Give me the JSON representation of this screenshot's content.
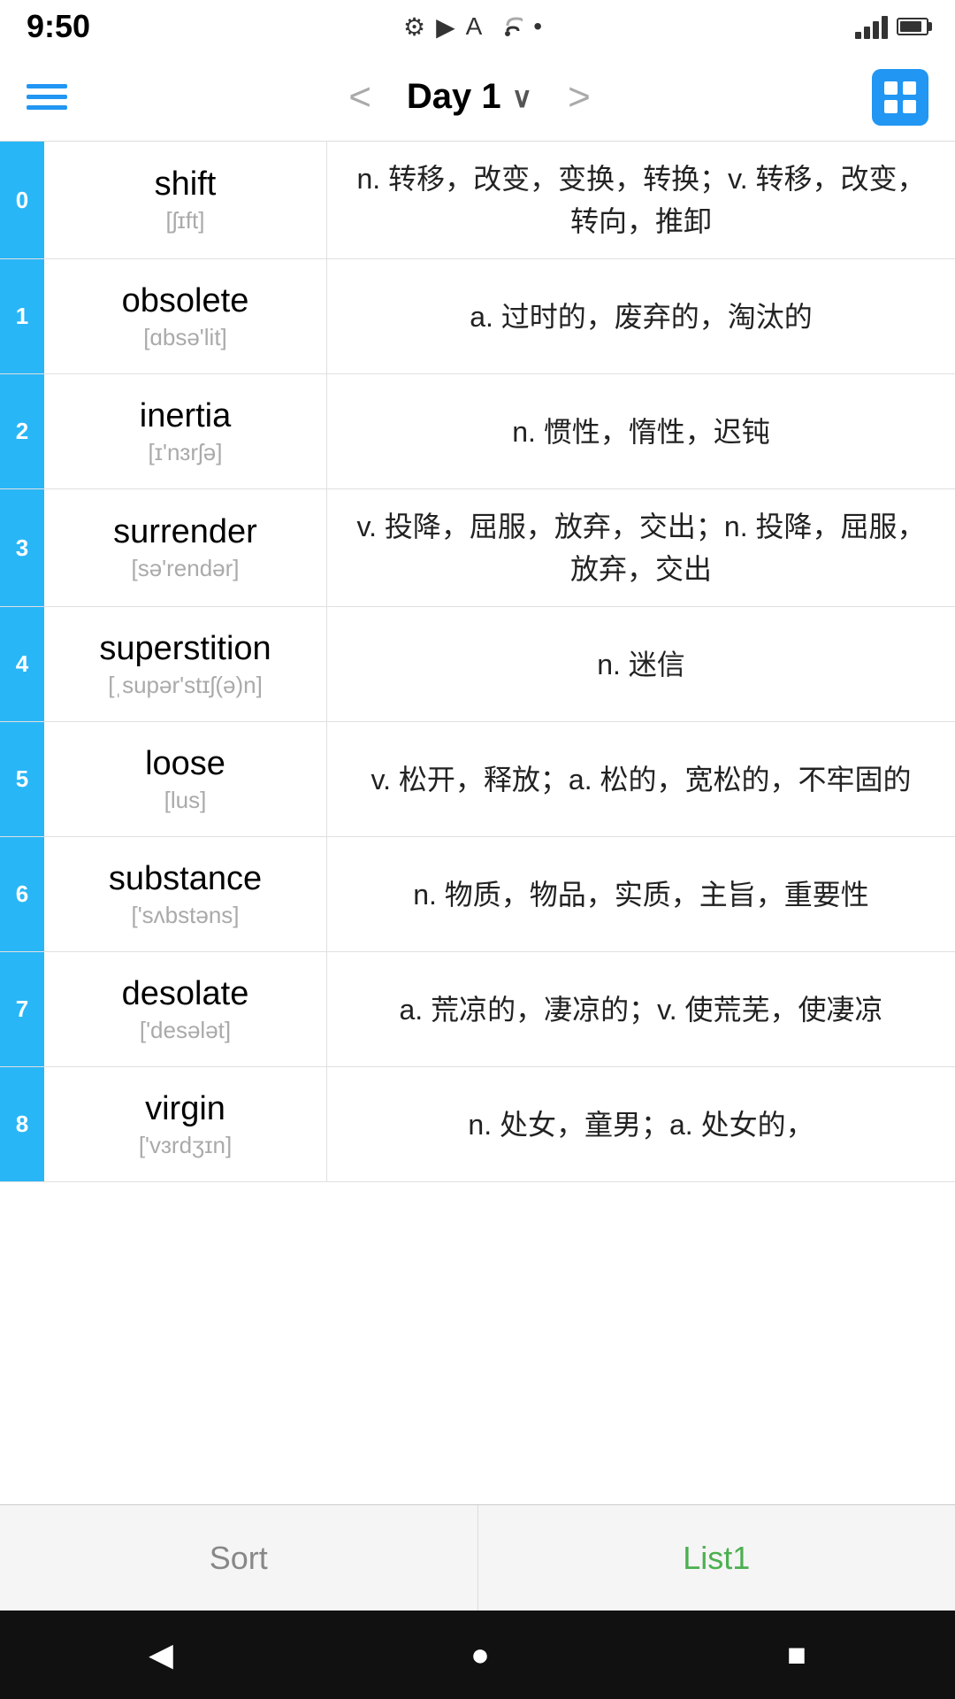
{
  "statusBar": {
    "time": "9:50",
    "icons": [
      "⚙",
      "▶",
      "A",
      "?",
      "•"
    ]
  },
  "header": {
    "title": "Day 1",
    "prevArrow": "<",
    "nextArrow": ">"
  },
  "words": [
    {
      "index": "0",
      "english": "shift",
      "phonetic": "[ʃɪft]",
      "definition": "n. 转移，改变，变换，转换；v. 转移，改变，转向，推卸"
    },
    {
      "index": "1",
      "english": "obsolete",
      "phonetic": "[ɑbsə'lit]",
      "definition": "a. 过时的，废弃的，淘汰的"
    },
    {
      "index": "2",
      "english": "inertia",
      "phonetic": "[ɪ'nɜrʃə]",
      "definition": "n. 惯性，惰性，迟钝"
    },
    {
      "index": "3",
      "english": "surrender",
      "phonetic": "[sə'rendər]",
      "definition": "v. 投降，屈服，放弃，交出；n. 投降，屈服，放弃，交出"
    },
    {
      "index": "4",
      "english": "superstition",
      "phonetic": "[ˌsupər'stɪʃ(ə)n]",
      "definition": "n. 迷信"
    },
    {
      "index": "5",
      "english": "loose",
      "phonetic": "[lus]",
      "definition": "v. 松开，释放；a. 松的，宽松的，不牢固的"
    },
    {
      "index": "6",
      "english": "substance",
      "phonetic": "['sʌbstəns]",
      "definition": "n. 物质，物品，实质，主旨，重要性"
    },
    {
      "index": "7",
      "english": "desolate",
      "phonetic": "['desələt]",
      "definition": "a. 荒凉的，凄凉的；v. 使荒芜，使凄凉"
    },
    {
      "index": "8",
      "english": "virgin",
      "phonetic": "['vɜrdʒɪn]",
      "definition": "n. 处女，童男；a. 处女的，"
    }
  ],
  "tabs": [
    {
      "label": "Sort",
      "active": false
    },
    {
      "label": "List1",
      "active": true
    }
  ],
  "androidNav": {
    "back": "◀",
    "home": "●",
    "recent": "■"
  }
}
